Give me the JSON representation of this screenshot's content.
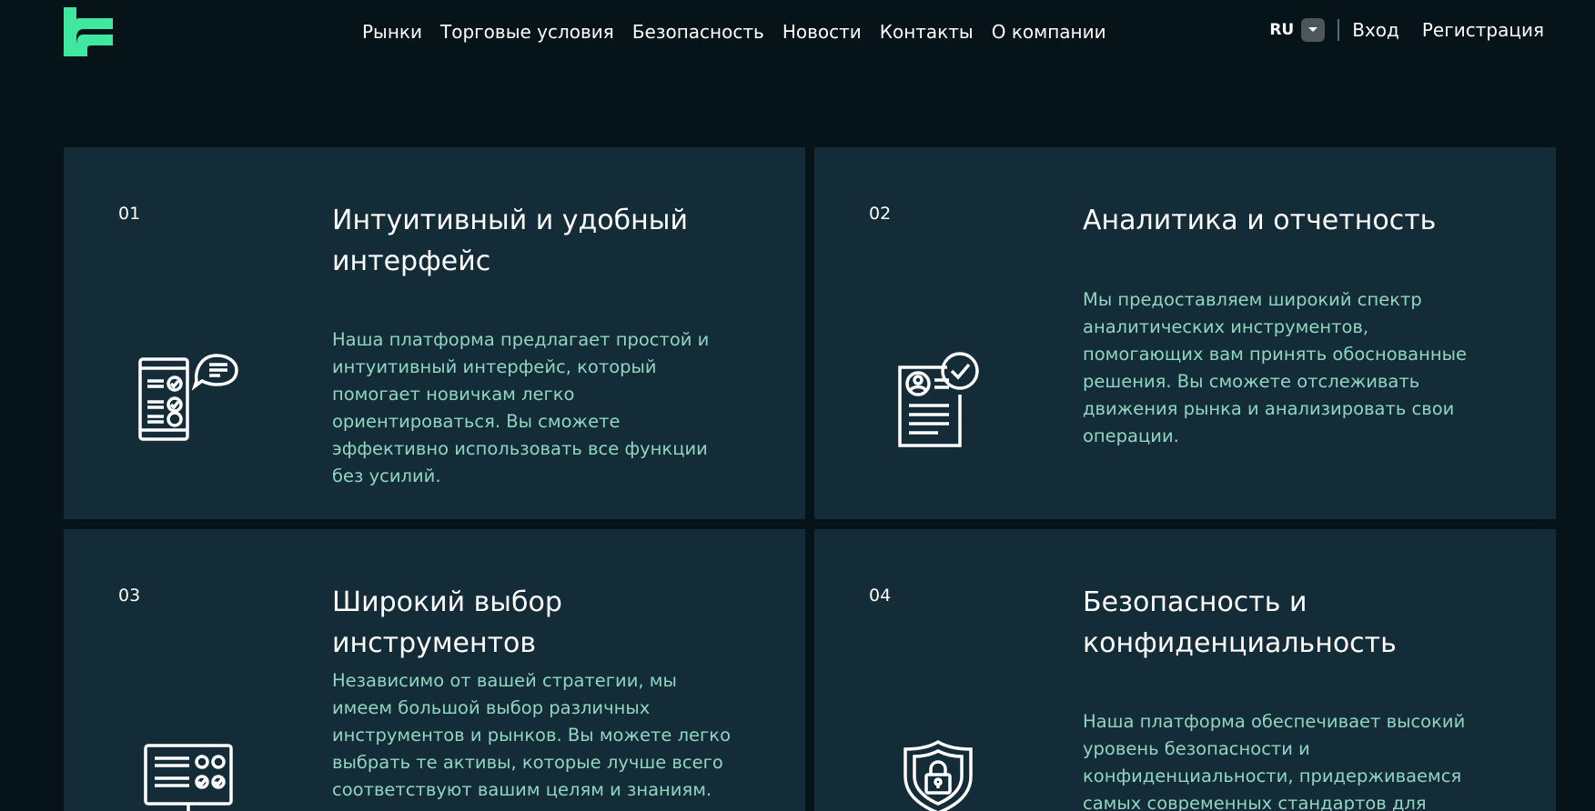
{
  "header": {
    "logo_icon": "brand-logo-icon",
    "nav": [
      "Рынки",
      "Торговые условия",
      "Безопасность",
      "Новости",
      "Контакты",
      "О компании"
    ],
    "lang": "RU",
    "login": "Вход",
    "register": "Регистрация"
  },
  "colors": {
    "background": "#06141a",
    "card": "#142c38",
    "accent": "#3ee89e",
    "text_muted": "#8fd5c0"
  },
  "features": [
    {
      "num": "01",
      "title": "Интуитивный и удобный интерфейс",
      "desc": "Наша платформа предлагает простой и интуитивный интерфейс, который помогает новичкам легко ориентироваться. Вы сможете эффективно использовать все функции без усилий.",
      "icon": "checklist-chat-icon"
    },
    {
      "num": "02",
      "title": "Аналитика и отчетность",
      "desc": "Мы предоставляем широкий спектр аналитических инструментов, помогающих вам принять обоснованные решения. Вы сможете отслеживать движения рынка и анализировать свои операции.",
      "icon": "verified-document-icon"
    },
    {
      "num": "03",
      "title": "Широкий выбор инструментов",
      "desc": "Независимо от вашей стратегии, мы имеем большой выбор различных инструментов и рынков. Вы можете легко выбрать те активы, которые лучше всего соответствуют вашим целям и знаниям.",
      "icon": "monitor-dashboard-icon"
    },
    {
      "num": "04",
      "title": "Безопасность и конфиденциальность",
      "desc": "Наша платформа обеспечивает высокий уровень безопасности и конфиденциальности, придерживаемся самых современных стандартов для защиты",
      "icon": "shield-lock-icon"
    }
  ]
}
